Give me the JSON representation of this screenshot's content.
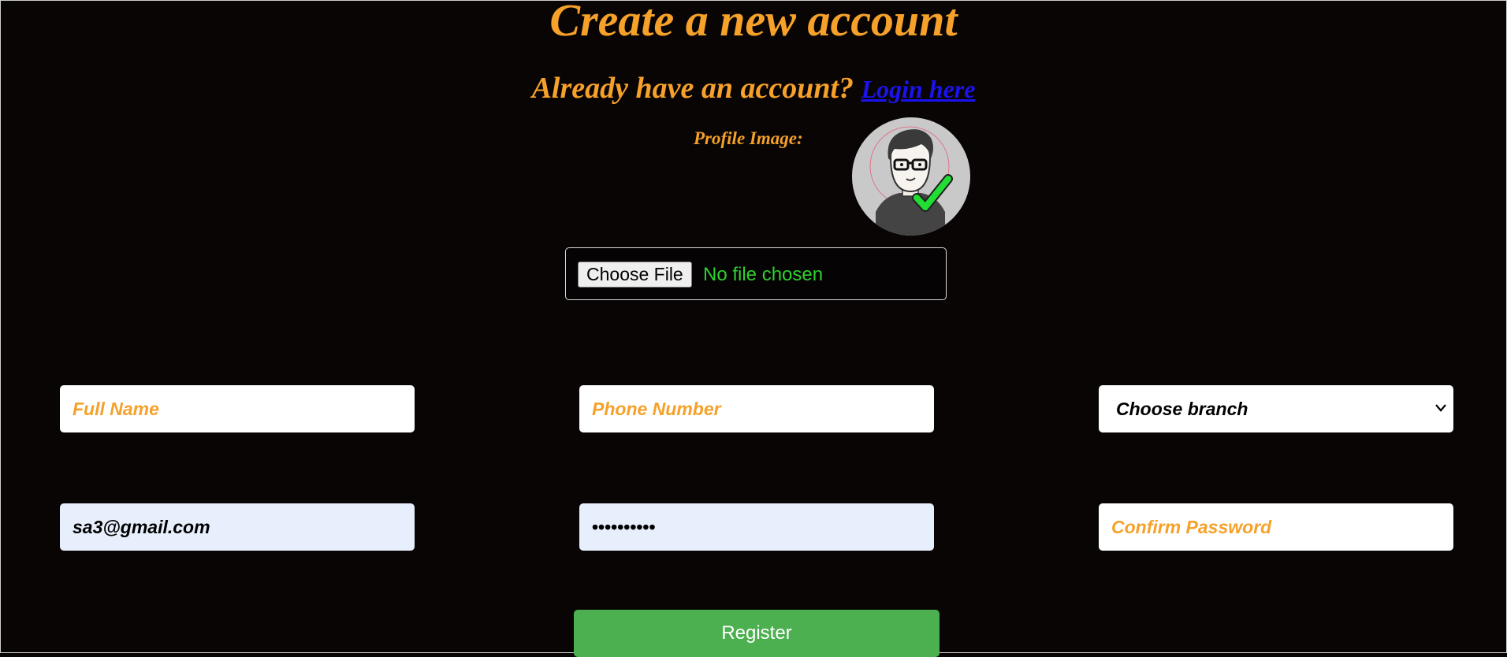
{
  "page": {
    "title": "Create a new account",
    "login_prompt": "Already have an account?",
    "login_link": "Login here",
    "profile_label": "Profile Image:"
  },
  "avatar": {
    "icon": "user-avatar-verified-icon"
  },
  "file_input": {
    "button_label": "Choose File",
    "status": "No file chosen"
  },
  "form": {
    "full_name": {
      "value": "",
      "placeholder": "Full Name"
    },
    "phone": {
      "value": "",
      "placeholder": "Phone Number"
    },
    "branch": {
      "selected": "Choose branch"
    },
    "email": {
      "value": "sa3@gmail.com",
      "placeholder": ""
    },
    "password": {
      "value": "••••••••••",
      "placeholder": ""
    },
    "confirm_password": {
      "value": "",
      "placeholder": "Confirm Password"
    }
  },
  "register_label": "Register",
  "colors": {
    "background": "#0a0505",
    "accent": "#f5a12a",
    "link": "#1a13ee",
    "success": "#4caf50",
    "file_status": "#2ed12e",
    "autofill": "#e8effc"
  }
}
